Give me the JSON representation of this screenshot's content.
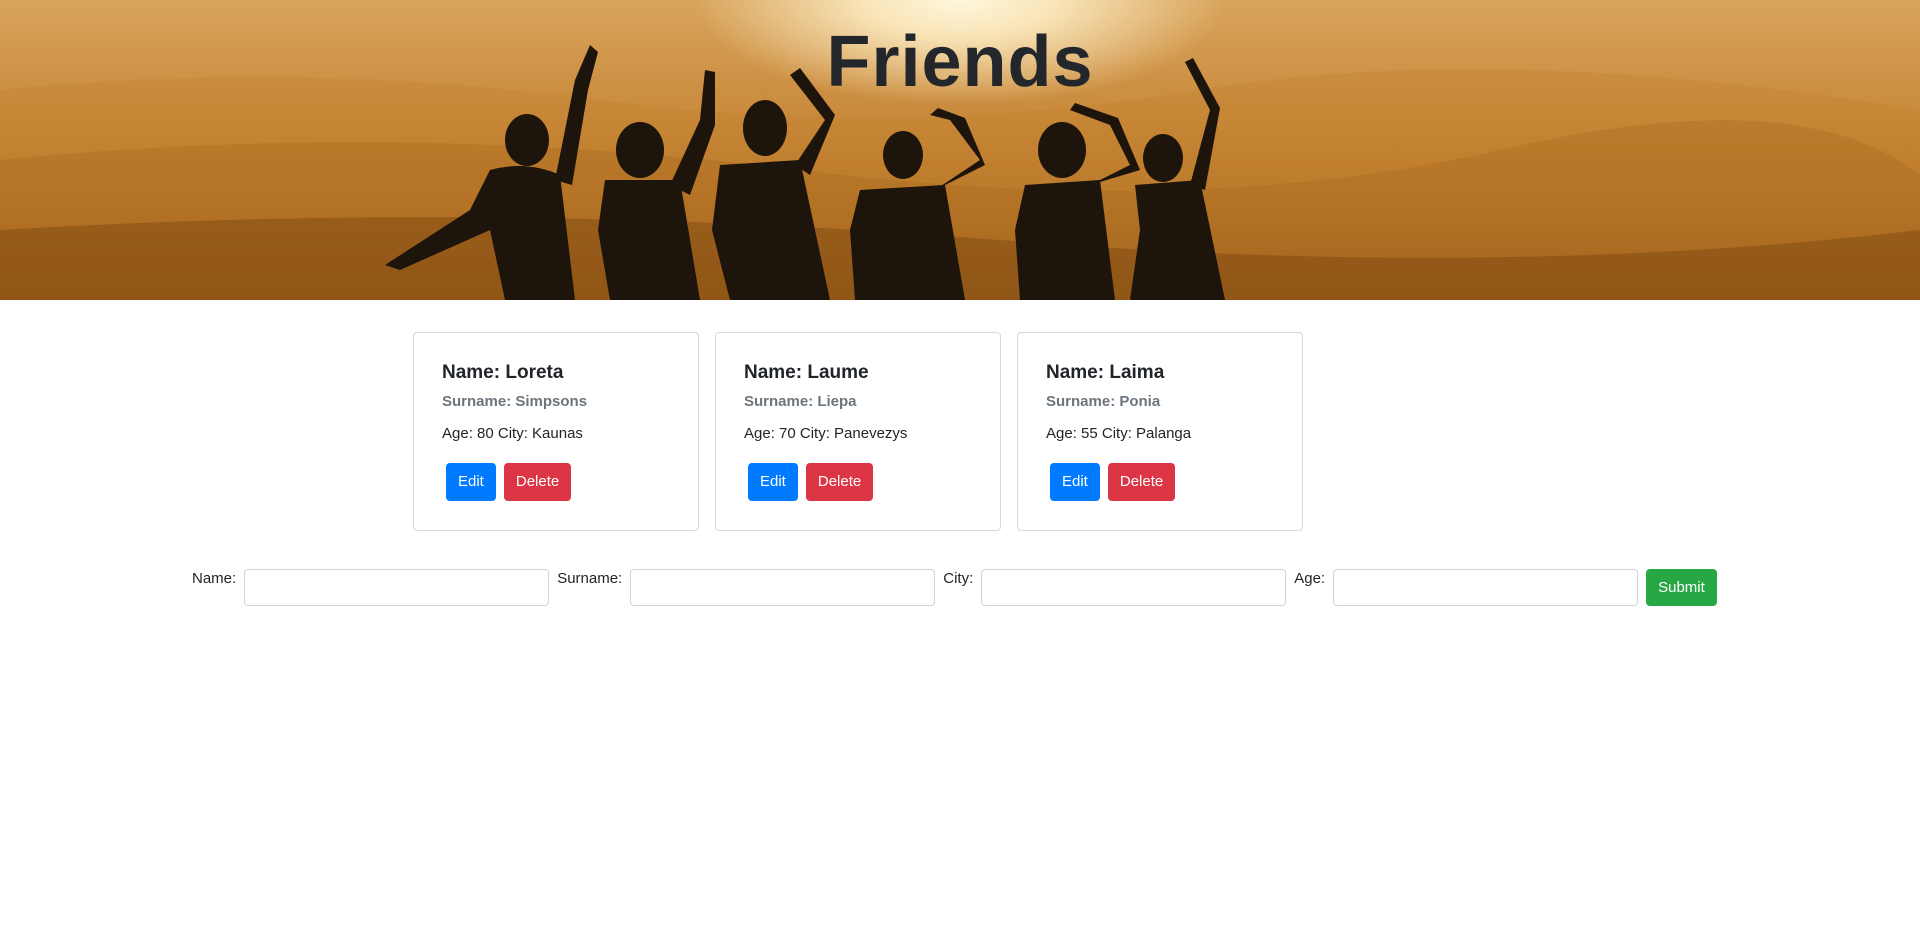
{
  "header": {
    "title": "Friends"
  },
  "friends": [
    {
      "name": "Name: Loreta",
      "surname": "Surname: Simpsons",
      "details": "Age: 80 City: Kaunas",
      "edit_label": "Edit",
      "delete_label": "Delete"
    },
    {
      "name": "Name: Laume",
      "surname": "Surname: Liepa",
      "details": "Age: 70 City: Panevezys",
      "edit_label": "Edit",
      "delete_label": "Delete"
    },
    {
      "name": "Name: Laima",
      "surname": "Surname: Ponia",
      "details": "Age: 55 City: Palanga",
      "edit_label": "Edit",
      "delete_label": "Delete"
    }
  ],
  "form": {
    "name_label": "Name:",
    "name_value": "",
    "surname_label": "Surname:",
    "surname_value": "",
    "city_label": "City:",
    "city_value": "",
    "age_label": "Age:",
    "age_value": "",
    "submit_label": "Submit"
  },
  "colors": {
    "edit": "#007bff",
    "delete": "#dc3545",
    "submit": "#28a745"
  }
}
